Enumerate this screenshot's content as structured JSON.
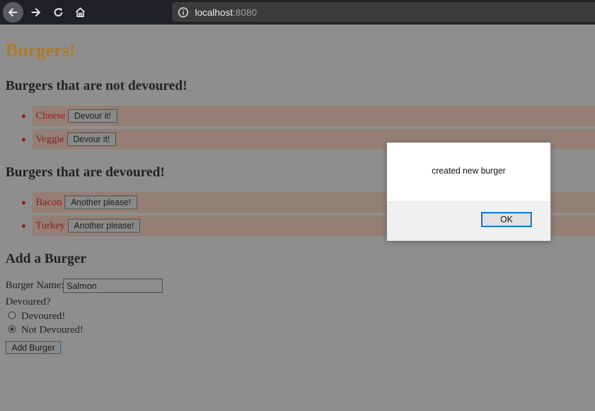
{
  "browser": {
    "url_host": "localhost",
    "url_port": ":8080"
  },
  "page": {
    "title": "Burgers!",
    "not_devoured_heading": "Burgers that are not devoured!",
    "not_devoured": [
      {
        "name": "Cheese",
        "button": "Devour it!"
      },
      {
        "name": "Veggie",
        "button": "Devour it!"
      }
    ],
    "devoured_heading": "Burgers that are devoured!",
    "devoured": [
      {
        "name": "Bacon",
        "button": "Another please!"
      },
      {
        "name": "Turkey",
        "button": "Another please!"
      }
    ],
    "form": {
      "heading": "Add a Burger",
      "name_label": "Burger Name:",
      "name_value": "Salmon",
      "devoured_label": "Devoured?",
      "option_devoured": "Devoured!",
      "option_not_devoured": "Not Devoured!",
      "selected_option": "Not Devoured!",
      "submit_label": "Add Burger"
    }
  },
  "dialog": {
    "message": "created new burger",
    "ok_label": "OK"
  },
  "colors": {
    "title": "#b07a2a",
    "burger_name": "#8f1d1d",
    "dialog_focus": "#0078d7"
  },
  "icons": [
    "back-arrow-icon",
    "forward-arrow-icon",
    "reload-icon",
    "home-icon",
    "info-icon"
  ]
}
